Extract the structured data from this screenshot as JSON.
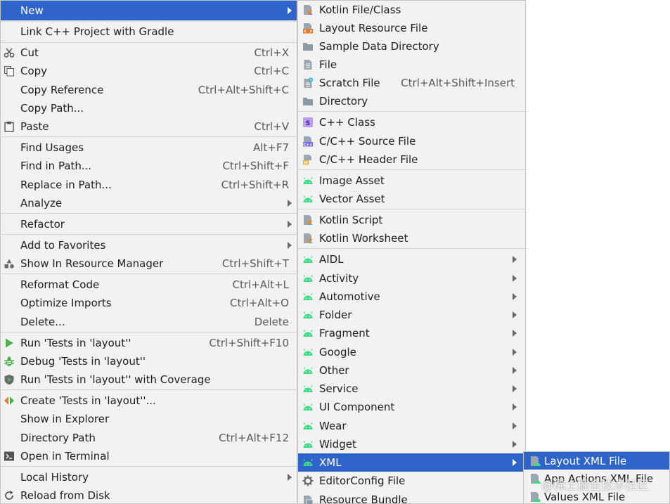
{
  "main_menu": {
    "items": [
      {
        "label": "New",
        "shortcut": "",
        "submenu": true,
        "selected": true,
        "icon": ""
      },
      {
        "label": "Link C++ Project with Gradle",
        "shortcut": "",
        "submenu": false,
        "icon": ""
      },
      {
        "label": "Cut",
        "shortcut": "Ctrl+X",
        "submenu": false,
        "icon": "scissors-icon"
      },
      {
        "label": "Copy",
        "shortcut": "Ctrl+C",
        "submenu": false,
        "icon": "copy-icon"
      },
      {
        "label": "Copy Reference",
        "shortcut": "Ctrl+Alt+Shift+C",
        "submenu": false,
        "icon": ""
      },
      {
        "label": "Copy Path...",
        "shortcut": "",
        "submenu": false,
        "icon": ""
      },
      {
        "label": "Paste",
        "shortcut": "Ctrl+V",
        "submenu": false,
        "icon": "paste-icon"
      },
      {
        "label": "Find Usages",
        "shortcut": "Alt+F7",
        "submenu": false,
        "icon": ""
      },
      {
        "label": "Find in Path...",
        "shortcut": "Ctrl+Shift+F",
        "submenu": false,
        "icon": ""
      },
      {
        "label": "Replace in Path...",
        "shortcut": "Ctrl+Shift+R",
        "submenu": false,
        "icon": ""
      },
      {
        "label": "Analyze",
        "shortcut": "",
        "submenu": true,
        "icon": ""
      },
      {
        "label": "Refactor",
        "shortcut": "",
        "submenu": true,
        "icon": ""
      },
      {
        "label": "Add to Favorites",
        "shortcut": "",
        "submenu": true,
        "icon": ""
      },
      {
        "label": "Show In Resource Manager",
        "shortcut": "Ctrl+Shift+T",
        "submenu": false,
        "icon": "resource-manager-icon"
      },
      {
        "label": "Reformat Code",
        "shortcut": "Ctrl+Alt+L",
        "submenu": false,
        "icon": ""
      },
      {
        "label": "Optimize Imports",
        "shortcut": "Ctrl+Alt+O",
        "submenu": false,
        "icon": ""
      },
      {
        "label": "Delete...",
        "shortcut": "Delete",
        "submenu": false,
        "icon": ""
      },
      {
        "label": "Run 'Tests in 'layout''",
        "shortcut": "Ctrl+Shift+F10",
        "submenu": false,
        "icon": "run-icon"
      },
      {
        "label": "Debug 'Tests in 'layout''",
        "shortcut": "",
        "submenu": false,
        "icon": "debug-icon"
      },
      {
        "label": "Run 'Tests in 'layout'' with Coverage",
        "shortcut": "",
        "submenu": false,
        "icon": "coverage-icon"
      },
      {
        "label": "Create 'Tests in 'layout''...",
        "shortcut": "",
        "submenu": false,
        "icon": "create-test-icon"
      },
      {
        "label": "Show in Explorer",
        "shortcut": "",
        "submenu": false,
        "icon": ""
      },
      {
        "label": "Directory Path",
        "shortcut": "Ctrl+Alt+F12",
        "submenu": false,
        "icon": ""
      },
      {
        "label": "Open in Terminal",
        "shortcut": "",
        "submenu": false,
        "icon": "terminal-icon"
      },
      {
        "label": "Local History",
        "shortcut": "",
        "submenu": true,
        "icon": ""
      },
      {
        "label": "Reload from Disk",
        "shortcut": "",
        "submenu": false,
        "icon": "reload-icon"
      }
    ]
  },
  "new_menu": {
    "items": [
      {
        "label": "Kotlin File/Class",
        "shortcut": "",
        "submenu": false,
        "icon": "kotlin-file-icon"
      },
      {
        "label": "Layout Resource File",
        "shortcut": "",
        "submenu": false,
        "icon": "layout-file-icon"
      },
      {
        "label": "Sample Data Directory",
        "shortcut": "",
        "submenu": false,
        "icon": "folder-icon"
      },
      {
        "label": "File",
        "shortcut": "",
        "submenu": false,
        "icon": "file-icon"
      },
      {
        "label": "Scratch File",
        "shortcut": "Ctrl+Alt+Shift+Insert",
        "submenu": false,
        "icon": "scratch-file-icon"
      },
      {
        "label": "Directory",
        "shortcut": "",
        "submenu": false,
        "icon": "folder-icon"
      },
      {
        "label": "C++ Class",
        "shortcut": "",
        "submenu": false,
        "icon": "cpp-class-icon"
      },
      {
        "label": "C/C++ Source File",
        "shortcut": "",
        "submenu": false,
        "icon": "cpp-source-icon"
      },
      {
        "label": "C/C++ Header File",
        "shortcut": "",
        "submenu": false,
        "icon": "cpp-header-icon"
      },
      {
        "label": "Image Asset",
        "shortcut": "",
        "submenu": false,
        "icon": "android-icon"
      },
      {
        "label": "Vector Asset",
        "shortcut": "",
        "submenu": false,
        "icon": "android-icon"
      },
      {
        "label": "Kotlin Script",
        "shortcut": "",
        "submenu": false,
        "icon": "kotlin-script-icon"
      },
      {
        "label": "Kotlin Worksheet",
        "shortcut": "",
        "submenu": false,
        "icon": "kotlin-script-icon"
      },
      {
        "label": "AIDL",
        "shortcut": "",
        "submenu": true,
        "icon": "android-icon"
      },
      {
        "label": "Activity",
        "shortcut": "",
        "submenu": true,
        "icon": "android-icon"
      },
      {
        "label": "Automotive",
        "shortcut": "",
        "submenu": true,
        "icon": "android-icon"
      },
      {
        "label": "Folder",
        "shortcut": "",
        "submenu": true,
        "icon": "android-icon"
      },
      {
        "label": "Fragment",
        "shortcut": "",
        "submenu": true,
        "icon": "android-icon"
      },
      {
        "label": "Google",
        "shortcut": "",
        "submenu": true,
        "icon": "android-icon"
      },
      {
        "label": "Other",
        "shortcut": "",
        "submenu": true,
        "icon": "android-icon"
      },
      {
        "label": "Service",
        "shortcut": "",
        "submenu": true,
        "icon": "android-icon"
      },
      {
        "label": "UI Component",
        "shortcut": "",
        "submenu": true,
        "icon": "android-icon"
      },
      {
        "label": "Wear",
        "shortcut": "",
        "submenu": true,
        "icon": "android-icon"
      },
      {
        "label": "Widget",
        "shortcut": "",
        "submenu": true,
        "icon": "android-icon"
      },
      {
        "label": "XML",
        "shortcut": "",
        "submenu": true,
        "selected": true,
        "icon": "android-icon"
      },
      {
        "label": "EditorConfig File",
        "shortcut": "",
        "submenu": false,
        "icon": "gear-icon"
      },
      {
        "label": "Resource Bundle",
        "shortcut": "",
        "submenu": false,
        "icon": "resource-bundle-icon"
      }
    ]
  },
  "xml_menu": {
    "items": [
      {
        "label": "Layout XML File",
        "selected": true,
        "icon": "xml-file-icon"
      },
      {
        "label": "App Actions XML File",
        "icon": "xml-file-icon"
      },
      {
        "label": "Values XML File",
        "icon": "xml-file-icon"
      }
    ]
  },
  "watermark": "@稀土掘金技术社区",
  "colors": {
    "menu_bg": "#f2f2f2",
    "selection": "#2f65ca",
    "separator": "#d4d4d4",
    "android_green": "#3ddc84"
  }
}
